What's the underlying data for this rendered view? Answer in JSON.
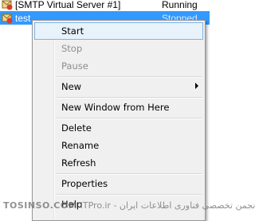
{
  "list": {
    "rows": [
      {
        "name": "[SMTP Virtual Server #1]",
        "status": "Running"
      },
      {
        "name": "test",
        "status": "Stopped"
      }
    ]
  },
  "context_menu": {
    "items": [
      {
        "label": "Start",
        "state": "hover"
      },
      {
        "label": "Stop",
        "state": "disabled"
      },
      {
        "label": "Pause",
        "state": "disabled"
      },
      {
        "label": "New",
        "submenu": true
      },
      {
        "label": "New Window from Here"
      },
      {
        "label": "Delete"
      },
      {
        "label": "Rename"
      },
      {
        "label": "Refresh"
      },
      {
        "label": "Properties"
      },
      {
        "label": "Help"
      }
    ]
  },
  "watermark": {
    "brand": "TOSINSO.COM",
    "text": "انجمن تخصصی فناوری اطلاعات ایران - ITPro.ir"
  },
  "colors": {
    "selection": "#3399ff",
    "menu_bg": "#f0f0f0",
    "hover_bg": "#e8f2fb",
    "hover_border": "#7eb4ea",
    "disabled_text": "#8d8d8d"
  }
}
